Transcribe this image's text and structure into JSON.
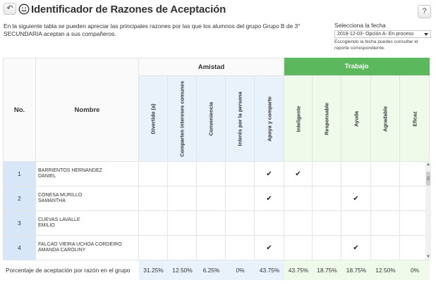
{
  "header": {
    "title": "Identificador de Razones de Aceptación",
    "help_label": "?",
    "description": "En la siguiente tabla se pueden apreciar las principales razones por las que los alumnos del grupo Grupo B de 3° SECUNDARIA aceptan a sus compañeros."
  },
  "date_picker": {
    "label": "Selecciona la fecha",
    "selected": "2018-12-03- Opción A- En proceso",
    "hint": "Escogiendo la fecha puedes consultar el reporte correspondiente."
  },
  "table": {
    "col_no": "No.",
    "col_nombre": "Nombre",
    "group_amistad": "Amistad",
    "group_trabajo": "Trabajo",
    "amistad_cols": [
      "Divertido (a)",
      "Comparten intereses comunes",
      "Conveniencia",
      "Interés por la persona",
      "Apoya y comparte"
    ],
    "trabajo_cols": [
      "Inteligente",
      "Responsable",
      "Ayuda",
      "Agradable",
      "Eficaz"
    ],
    "check_symbol": "✔",
    "rows": [
      {
        "no": "1",
        "name1": "BARRIENTOS HERNANDEZ",
        "name2": "DANIEL",
        "checks": [
          false,
          false,
          false,
          false,
          true,
          true,
          false,
          false,
          false,
          false
        ]
      },
      {
        "no": "2",
        "name1": "CONESA MURILLO",
        "name2": "SAMANTHA",
        "checks": [
          false,
          false,
          false,
          false,
          true,
          false,
          false,
          true,
          false,
          false
        ]
      },
      {
        "no": "3",
        "name1": "CUEVAS LAVALLE",
        "name2": "EMILIO",
        "checks": [
          false,
          false,
          false,
          false,
          false,
          false,
          false,
          false,
          false,
          false
        ]
      },
      {
        "no": "4",
        "name1": "FALCAO VIEIRA UCHOA CORDEIRO",
        "name2": "AMANDA CAROLINY",
        "checks": [
          false,
          false,
          false,
          false,
          true,
          false,
          false,
          true,
          false,
          false
        ]
      }
    ],
    "footer_label": "Porcentaje de aceptación por razón en el grupo",
    "percentages": [
      "31.25%",
      "12.50%",
      "6.25%",
      "0%",
      "43.75%",
      "43.75%",
      "18.75%",
      "18.75%",
      "12.50%",
      "0%"
    ]
  },
  "colors": {
    "trabajo_green": "#5cb85c",
    "amistad_blue_light": "#e9f1fa",
    "trabajo_green_light": "#effaeb",
    "number_cell_blue": "#d7e7f7"
  },
  "icons": {
    "back": "back-arrow-icon",
    "title": "smiley-face-icon",
    "help": "question-icon",
    "select": "caret-down-icon"
  }
}
